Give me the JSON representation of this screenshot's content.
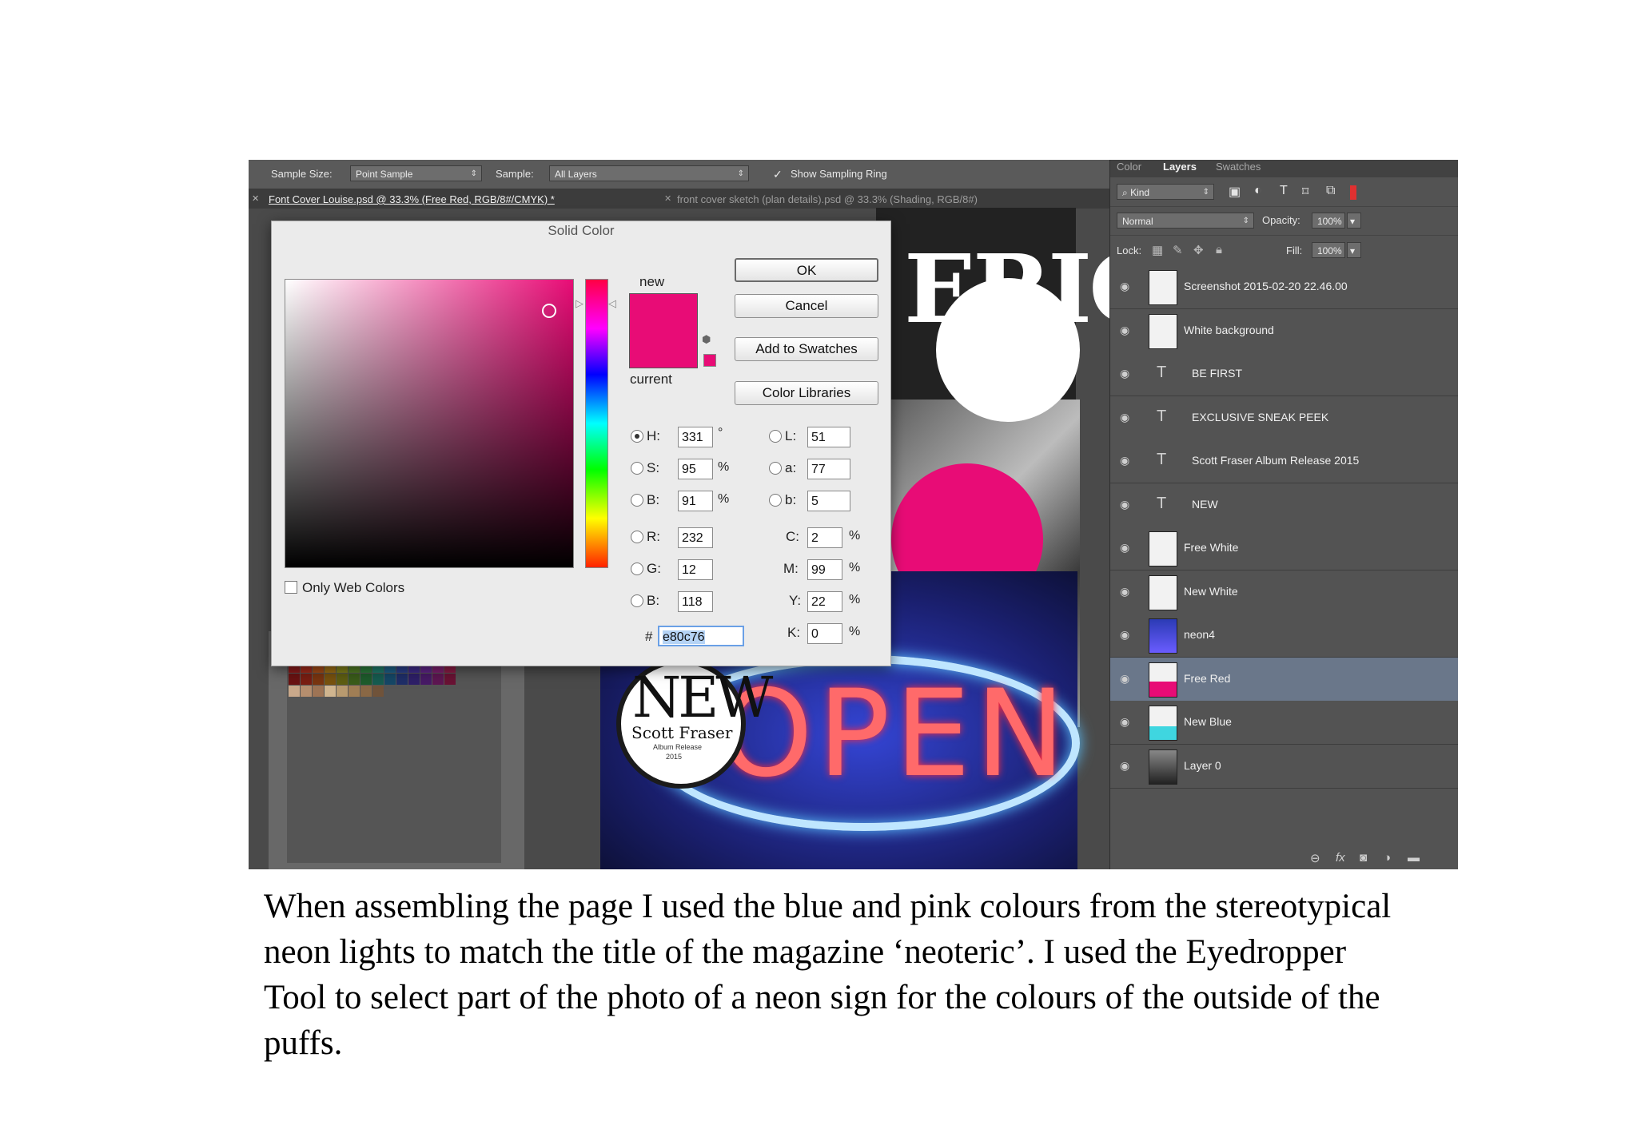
{
  "options_bar": {
    "sample_size_label": "Sample Size:",
    "sample_size_value": "Point Sample",
    "sample_label": "Sample:",
    "sample_value": "All Layers",
    "show_ring_label": "Show Sampling Ring",
    "show_ring_checked": true
  },
  "doc_tabs": [
    {
      "label": "Font Cover Louise.psd @ 33.3% (Free Red, RGB/8#/CMYK) *",
      "active": true
    },
    {
      "label": "front cover sketch (plan details).psd @ 33.3% (Shading, RGB/8#)",
      "active": false
    }
  ],
  "dialog": {
    "title": "Solid Color",
    "new_label": "new",
    "current_label": "current",
    "buttons": {
      "ok": "OK",
      "cancel": "Cancel",
      "add_swatches": "Add to Swatches",
      "libraries": "Color Libraries"
    },
    "fields": {
      "H": "331",
      "S": "95",
      "B": "91",
      "R": "232",
      "G": "12",
      "Bb": "118",
      "L": "51",
      "a": "77",
      "b": "5",
      "C": "2",
      "M": "99",
      "Y": "22",
      "K": "0",
      "hex": "e80c76"
    },
    "labels": {
      "H": "H:",
      "S": "S:",
      "B": "B:",
      "R": "R:",
      "G": "G:",
      "Bb": "B:",
      "L": "L:",
      "a": "a:",
      "b": "b:",
      "C": "C:",
      "M": "M:",
      "Y": "Y:",
      "K": "K:",
      "hash": "#",
      "deg": "°",
      "pct": "%"
    },
    "web_colors_label": "Only Web Colors",
    "color_hex": "#e80c76"
  },
  "canvas": {
    "title_fragment": "ERIC",
    "open_text": "OPEN",
    "badge_new": "NEW",
    "badge_name": "Scott Fraser",
    "badge_sub": "Album Release",
    "badge_year": "2015"
  },
  "layers_panel": {
    "tabs": [
      "Color",
      "Layers",
      "Swatches"
    ],
    "kind_label": "Kind",
    "blend_mode": "Normal",
    "opacity_label": "Opacity:",
    "opacity_value": "100%",
    "lock_label": "Lock:",
    "fill_label": "Fill:",
    "fill_value": "100%",
    "layers": [
      {
        "name": "Screenshot 2015-02-20 22.46.00",
        "type": "image",
        "selected": false
      },
      {
        "name": "White background",
        "type": "image",
        "selected": false
      },
      {
        "name": "BE FIRST",
        "type": "text",
        "selected": false
      },
      {
        "name": "EXCLUSIVE SNEAK PEEK",
        "type": "text",
        "selected": false
      },
      {
        "name": "Scott Fraser Album Release 2015",
        "type": "text",
        "selected": false
      },
      {
        "name": "NEW",
        "type": "text",
        "selected": false
      },
      {
        "name": "Free White",
        "type": "smart",
        "selected": false
      },
      {
        "name": "New White",
        "type": "smart",
        "selected": false
      },
      {
        "name": "neon4",
        "type": "smart",
        "selected": false
      },
      {
        "name": "Free Red",
        "type": "smart",
        "selected": true
      },
      {
        "name": "New Blue",
        "type": "smart",
        "selected": false
      },
      {
        "name": "Layer 0",
        "type": "image",
        "selected": false
      }
    ]
  },
  "caption": "When assembling the page I used the blue and pink colours from the stereotypical neon lights to match the title of the magazine ‘neoteric’. I used the Eyedropper Tool to select part of the photo of a neon sign for the colours of the outside of the puffs."
}
